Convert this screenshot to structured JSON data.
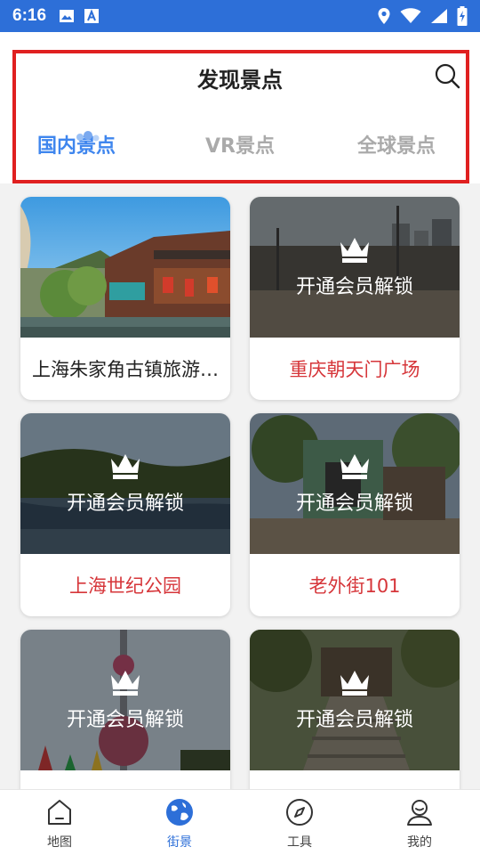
{
  "status_bar": {
    "time": "6:16",
    "left_icons": [
      "image-icon",
      "font-download-icon"
    ],
    "right_icons": [
      "location-icon",
      "wifi-icon",
      "signal-icon",
      "battery-charging-icon"
    ]
  },
  "header": {
    "title": "发现景点",
    "search_icon": "search-icon",
    "tabs": [
      {
        "label": "国内景点",
        "active": true
      },
      {
        "label": "VR景点",
        "active": false
      },
      {
        "label": "全球景点",
        "active": false
      }
    ],
    "highlight_color": "#e02020"
  },
  "lock_label": "开通会员解锁",
  "cards": [
    {
      "name": "上海朱家角古镇旅游…",
      "locked": false
    },
    {
      "name": "重庆朝天门广场",
      "locked": true
    },
    {
      "name": "上海世纪公园",
      "locked": true
    },
    {
      "name": "老外街101",
      "locked": true
    },
    {
      "name": "",
      "locked": true
    },
    {
      "name": "",
      "locked": true
    }
  ],
  "bottom_nav": {
    "items": [
      {
        "label": "地图",
        "icon": "map-icon",
        "active": false
      },
      {
        "label": "街景",
        "icon": "globe-icon",
        "active": true
      },
      {
        "label": "工具",
        "icon": "compass-icon",
        "active": false
      },
      {
        "label": "我的",
        "icon": "profile-icon",
        "active": false
      }
    ]
  },
  "colors": {
    "accent": "#2d6fd8",
    "tab_active": "#3f86ee",
    "locked_name": "#d6363a"
  }
}
